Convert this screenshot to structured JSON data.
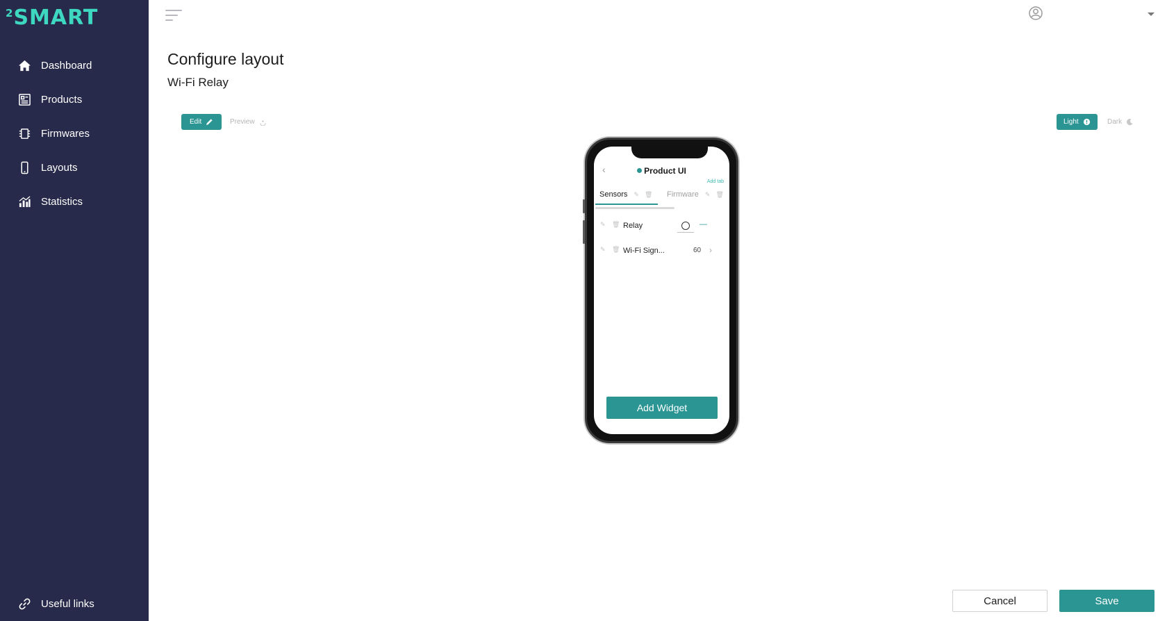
{
  "app": {
    "logo_sup": "2",
    "logo_word": "SMART"
  },
  "sidebar": {
    "items": [
      {
        "label": "Dashboard",
        "icon": "home-icon"
      },
      {
        "label": "Products",
        "icon": "products-icon"
      },
      {
        "label": "Firmwares",
        "icon": "chip-icon"
      },
      {
        "label": "Layouts",
        "icon": "phone-icon"
      },
      {
        "label": "Statistics",
        "icon": "chart-icon"
      }
    ],
    "useful_links": {
      "label": "Useful links",
      "icon": "link-icon"
    }
  },
  "header": {
    "title": "Configure layout",
    "subtitle": "Wi-Fi Relay"
  },
  "mode": {
    "edit": "Edit",
    "preview": "Preview"
  },
  "theme": {
    "light": "Light",
    "dark": "Dark"
  },
  "preview": {
    "title": "Product UI",
    "add_tab": "Add tab",
    "tabs": [
      {
        "label": "Sensors",
        "selected": true
      },
      {
        "label": "Firmware",
        "selected": false
      }
    ],
    "rows": [
      {
        "label": "Relay",
        "type": "toggle",
        "extra": "—"
      },
      {
        "label": "Wi-Fi Sign...",
        "type": "value",
        "value": "60",
        "chevron": "›"
      }
    ],
    "add_widget": "Add Widget",
    "back": "‹"
  },
  "footer": {
    "cancel": "Cancel",
    "save": "Save"
  },
  "colors": {
    "sidebar_bg": "#272a4a",
    "accent": "#2a9593",
    "logo": "#3ed8c0"
  }
}
